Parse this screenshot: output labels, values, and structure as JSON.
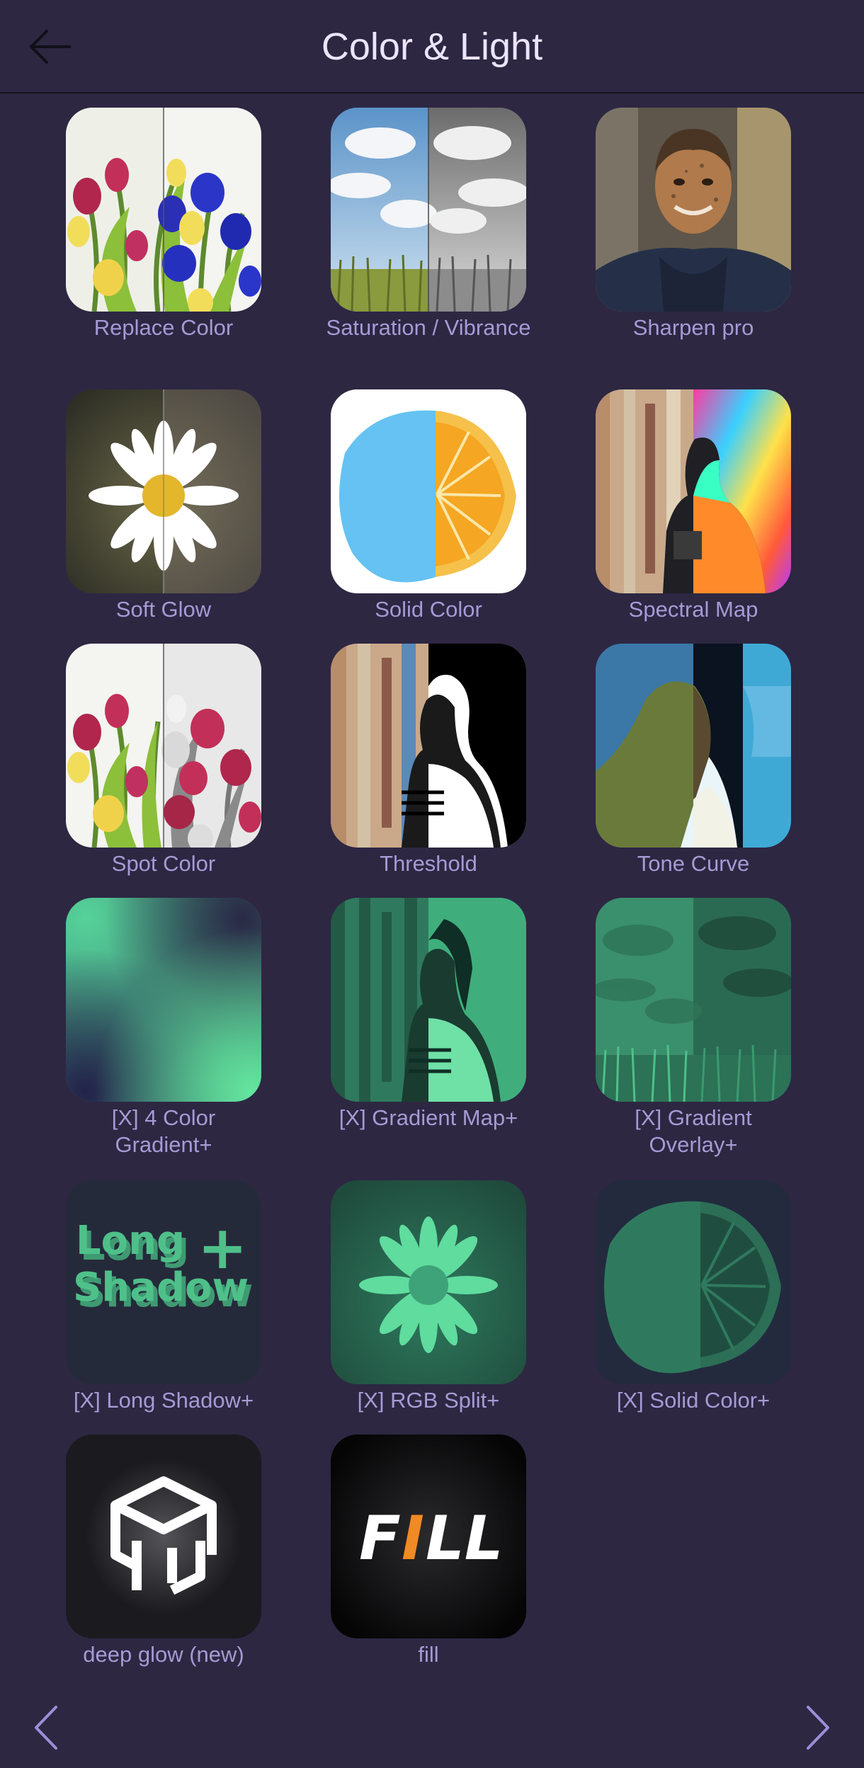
{
  "header": {
    "title": "Color & Light",
    "back_icon": "arrow-left-icon"
  },
  "effects": [
    {
      "label": "Replace Color"
    },
    {
      "label": "Saturation / Vibrance"
    },
    {
      "label": "Sharpen pro"
    },
    {
      "label": "Soft Glow"
    },
    {
      "label": "Solid Color"
    },
    {
      "label": "Spectral Map"
    },
    {
      "label": "Spot Color"
    },
    {
      "label": "Threshold"
    },
    {
      "label": "Tone Curve"
    },
    {
      "label": "[X] 4 Color Gradient+"
    },
    {
      "label": "[X] Gradient Map+"
    },
    {
      "label": "[X] Gradient Overlay+"
    },
    {
      "label": "[X] Long Shadow+"
    },
    {
      "label": "[X] RGB Split+"
    },
    {
      "label": "[X] Solid Color+"
    },
    {
      "label": "deep glow (new)"
    },
    {
      "label": "fill"
    }
  ],
  "thumb_text": {
    "long_shadow_line1": "Long",
    "long_shadow_line2": "Shadow",
    "long_shadow_plus": "+",
    "fill_part1": "F",
    "fill_part2": "I",
    "fill_part3": "LL"
  },
  "footer": {
    "prev_icon": "chevron-left-icon",
    "next_icon": "chevron-right-icon"
  },
  "colors": {
    "background": "#2d2742",
    "title": "#ece4ff",
    "label": "#a79ad5",
    "accent_green": "#4fc08a",
    "nav_chevron": "#9b8fd8"
  }
}
